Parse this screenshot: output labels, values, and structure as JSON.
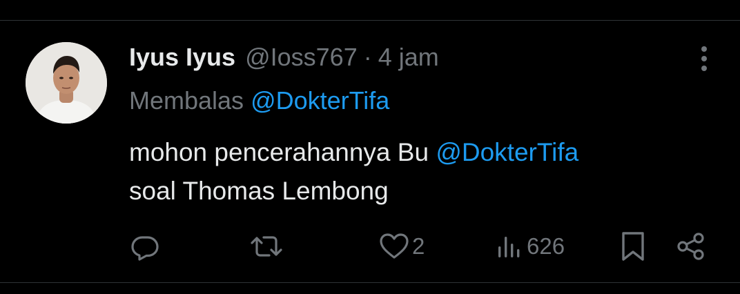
{
  "tweet": {
    "display_name": "Iyus Iyus",
    "handle": "@Ioss767",
    "separator": "·",
    "time": "4 jam",
    "reply_prefix": "Membalas",
    "reply_to": "@DokterTifa",
    "text_part1": "mohon pencerahannya Bu ",
    "text_mention": "@DokterTifa",
    "text_part2": "soal Thomas Lembong"
  },
  "actions": {
    "reply_icon": "reply-icon",
    "retweet_icon": "retweet-icon",
    "like_icon": "heart-icon",
    "like_count": "2",
    "views_icon": "views-icon",
    "views_count": "626",
    "bookmark_icon": "bookmark-icon",
    "share_icon": "share-icon"
  },
  "colors": {
    "background": "#000000",
    "text": "#e7e9ea",
    "muted": "#71767b",
    "accent": "#1d9bf0",
    "divider": "#2f3336"
  }
}
